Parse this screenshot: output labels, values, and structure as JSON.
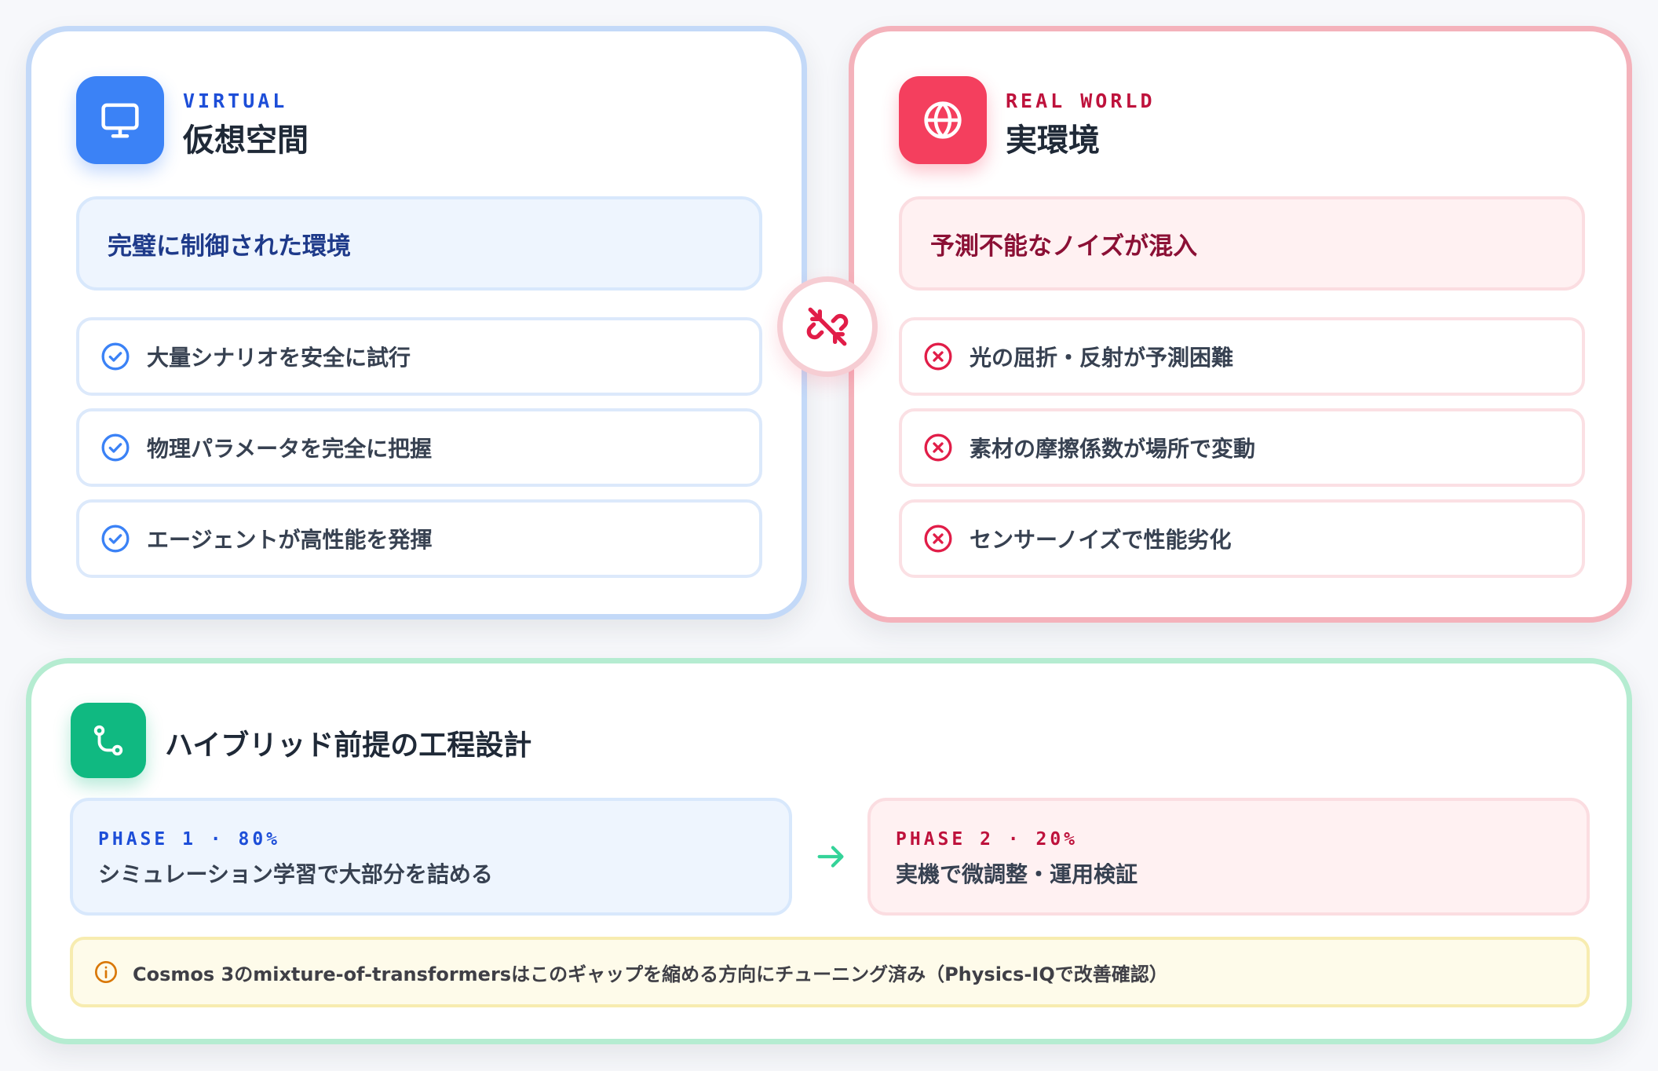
{
  "virtual": {
    "kicker": "VIRTUAL",
    "title": "仮想空間",
    "headline": "完璧に制御された環境",
    "accent": "#3b82f6",
    "items": [
      {
        "icon": "check-circle-icon",
        "label": "大量シナリオを安全に試行"
      },
      {
        "icon": "check-circle-icon",
        "label": "物理パラメータを完全に把握"
      },
      {
        "icon": "check-circle-icon",
        "label": "エージェントが高性能を発揮"
      }
    ]
  },
  "real": {
    "kicker": "REAL WORLD",
    "title": "実環境",
    "headline": "予測不能なノイズが混入",
    "accent": "#f43f5e",
    "items": [
      {
        "icon": "x-circle-icon",
        "label": "光の屈折・反射が予測困難"
      },
      {
        "icon": "x-circle-icon",
        "label": "素材の摩擦係数が場所で変動"
      },
      {
        "icon": "x-circle-icon",
        "label": "センサーノイズで性能劣化"
      }
    ]
  },
  "divider": {
    "icon": "unlink-icon"
  },
  "hybrid": {
    "title": "ハイブリッド前提の工程設計",
    "accent": "#10b981",
    "icon": "route-icon",
    "phases": [
      {
        "kicker": "PHASE 1 · 80%",
        "text": "シミュレーション学習で大部分を詰める"
      },
      {
        "kicker": "PHASE 2 · 20%",
        "text": "実機で微調整・運用検証"
      }
    ],
    "note": "Cosmos 3のmixture-of-transformersはこのギャップを縮める方向にチューニング済み（Physics-IQで改善確認）"
  }
}
